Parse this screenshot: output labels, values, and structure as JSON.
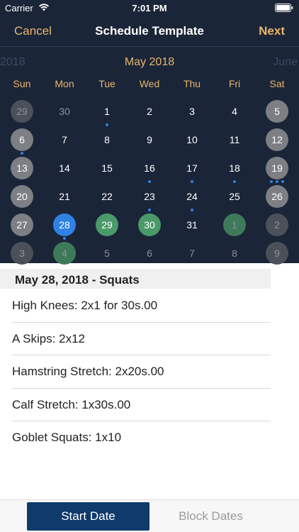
{
  "status": {
    "carrier": "Carrier",
    "time": "7:01 PM"
  },
  "nav": {
    "cancel": "Cancel",
    "title": "Schedule Template",
    "next": "Next"
  },
  "calendar": {
    "prev_label": "2018",
    "month": "May 2018",
    "next_label": "June",
    "weekdays": [
      "Sun",
      "Mon",
      "Tue",
      "Wed",
      "Thu",
      "Fri",
      "Sat"
    ],
    "weeks": [
      [
        {
          "d": "29",
          "o": 1,
          "s": "gray-dim"
        },
        {
          "d": "30",
          "o": 1
        },
        {
          "d": "1",
          "dots": 1
        },
        {
          "d": "2"
        },
        {
          "d": "3"
        },
        {
          "d": "4"
        },
        {
          "d": "5",
          "s": "gray"
        }
      ],
      [
        {
          "d": "6",
          "s": "gray",
          "dots": 1
        },
        {
          "d": "7"
        },
        {
          "d": "8"
        },
        {
          "d": "9"
        },
        {
          "d": "10"
        },
        {
          "d": "11"
        },
        {
          "d": "12",
          "s": "gray"
        }
      ],
      [
        {
          "d": "13",
          "s": "gray"
        },
        {
          "d": "14"
        },
        {
          "d": "15"
        },
        {
          "d": "16",
          "dots": 1
        },
        {
          "d": "17",
          "dots": 1
        },
        {
          "d": "18",
          "dots": 1
        },
        {
          "d": "19",
          "s": "gray",
          "dots": 3
        }
      ],
      [
        {
          "d": "20",
          "s": "gray"
        },
        {
          "d": "21"
        },
        {
          "d": "22"
        },
        {
          "d": "23",
          "dots": 1
        },
        {
          "d": "24",
          "dots": 1
        },
        {
          "d": "25"
        },
        {
          "d": "26",
          "s": "gray"
        }
      ],
      [
        {
          "d": "27",
          "s": "gray"
        },
        {
          "d": "28",
          "s": "blue",
          "dots": 1
        },
        {
          "d": "29",
          "s": "green"
        },
        {
          "d": "30",
          "s": "green"
        },
        {
          "d": "31"
        },
        {
          "d": "1",
          "o": 1,
          "s": "green-dim"
        },
        {
          "d": "2",
          "o": 1,
          "s": "gray-dim"
        }
      ],
      [
        {
          "d": "3",
          "o": 1,
          "s": "gray-dim"
        },
        {
          "d": "4",
          "o": 1,
          "s": "green-dim"
        },
        {
          "d": "5",
          "o": 1
        },
        {
          "d": "6",
          "o": 1
        },
        {
          "d": "7",
          "o": 1
        },
        {
          "d": "8",
          "o": 1
        },
        {
          "d": "9",
          "o": 1,
          "s": "gray-dim"
        }
      ]
    ]
  },
  "workout": {
    "title": "May 28, 2018 - Squats",
    "exercises": [
      "High Knees: 2x1 for 30s.00",
      "A Skips: 2x12",
      "Hamstring Stretch: 2x20s.00",
      "Calf Stretch: 1x30s.00",
      "Goblet Squats: 1x10"
    ]
  },
  "tabs": {
    "start": "Start Date",
    "block": "Block Dates"
  },
  "colors": {
    "header_bg": "#1b2538",
    "accent": "#e8b56c",
    "selected": "#2f82e4",
    "scheduled": "#4a9a6a",
    "tab_active": "#0f3a6b"
  }
}
